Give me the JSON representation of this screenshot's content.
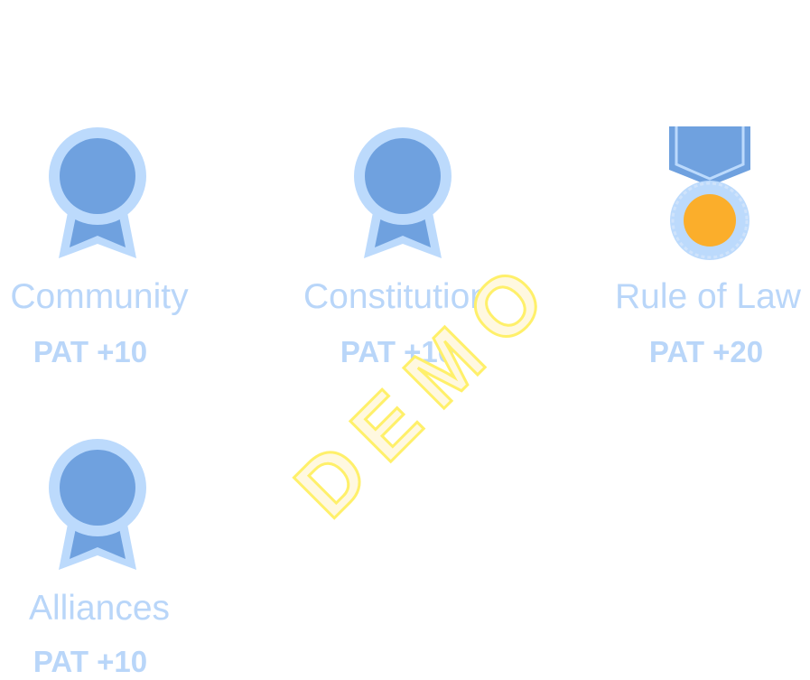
{
  "badges": [
    {
      "name": "Community",
      "points": "PAT +10",
      "icon": "ribbon-award-icon"
    },
    {
      "name": "Constitution",
      "points": "PAT +10",
      "icon": "ribbon-award-icon"
    },
    {
      "name": "Rule of Law",
      "points": "PAT +20",
      "icon": "medal-icon"
    },
    {
      "name": "Alliances",
      "points": "PAT +10",
      "icon": "ribbon-award-icon"
    }
  ],
  "watermark": "DEMO",
  "colors": {
    "ribbon_fill": "#6fa1df",
    "ribbon_outline": "#bcdafc",
    "label_text": "#b9d6f9",
    "medal_gold": "#fbae2b",
    "watermark_stroke": "#fff06a"
  }
}
